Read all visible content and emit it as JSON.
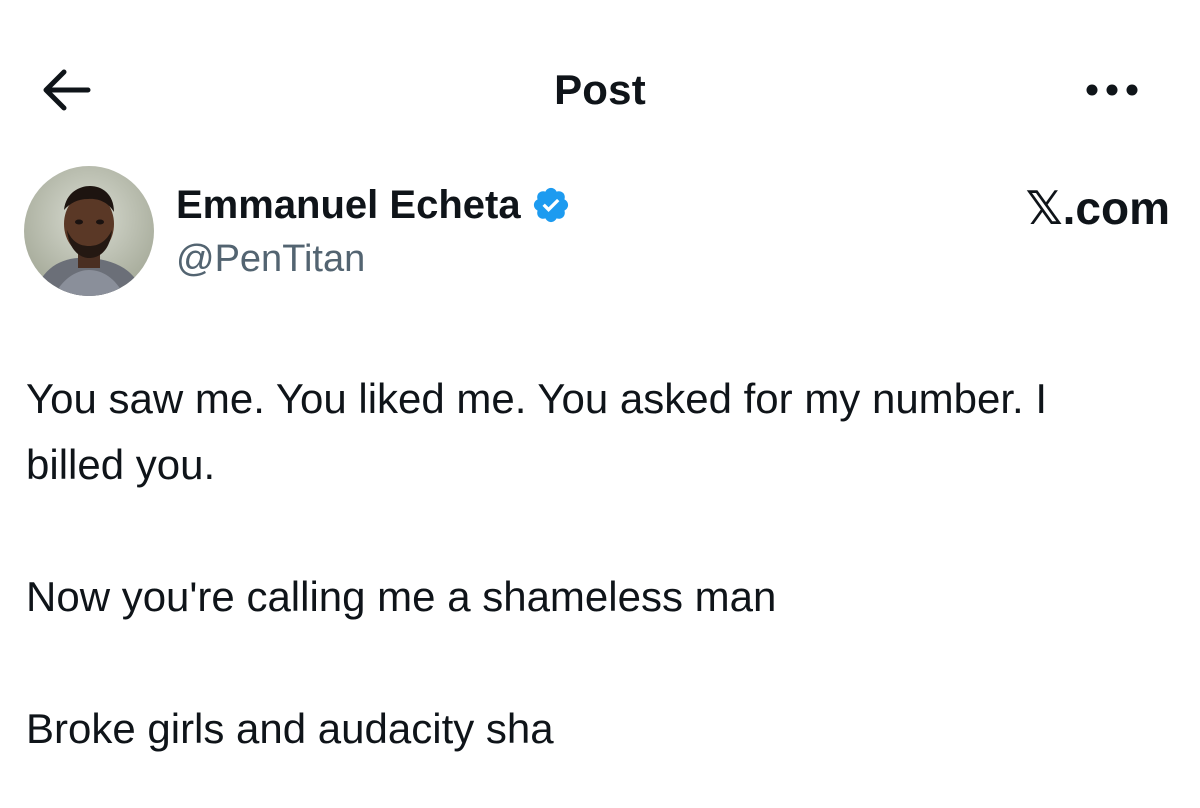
{
  "header": {
    "title": "Post",
    "back_icon": "arrow-left-icon",
    "more_icon": "ellipsis-horizontal-icon"
  },
  "author": {
    "name": "Emmanuel Echeta",
    "handle": "@PenTitan",
    "verified": true,
    "verified_color": "#1d9bf0"
  },
  "watermark": {
    "text": "𝕏.com"
  },
  "post": {
    "paragraphs": [
      "You saw me. You liked me. You asked for my number. I billed you.",
      "Now you're calling me a shameless man",
      "Broke girls and audacity sha"
    ]
  },
  "colors": {
    "text_primary": "#0f1419",
    "text_secondary": "#536471",
    "accent": "#1d9bf0",
    "background": "#ffffff"
  }
}
